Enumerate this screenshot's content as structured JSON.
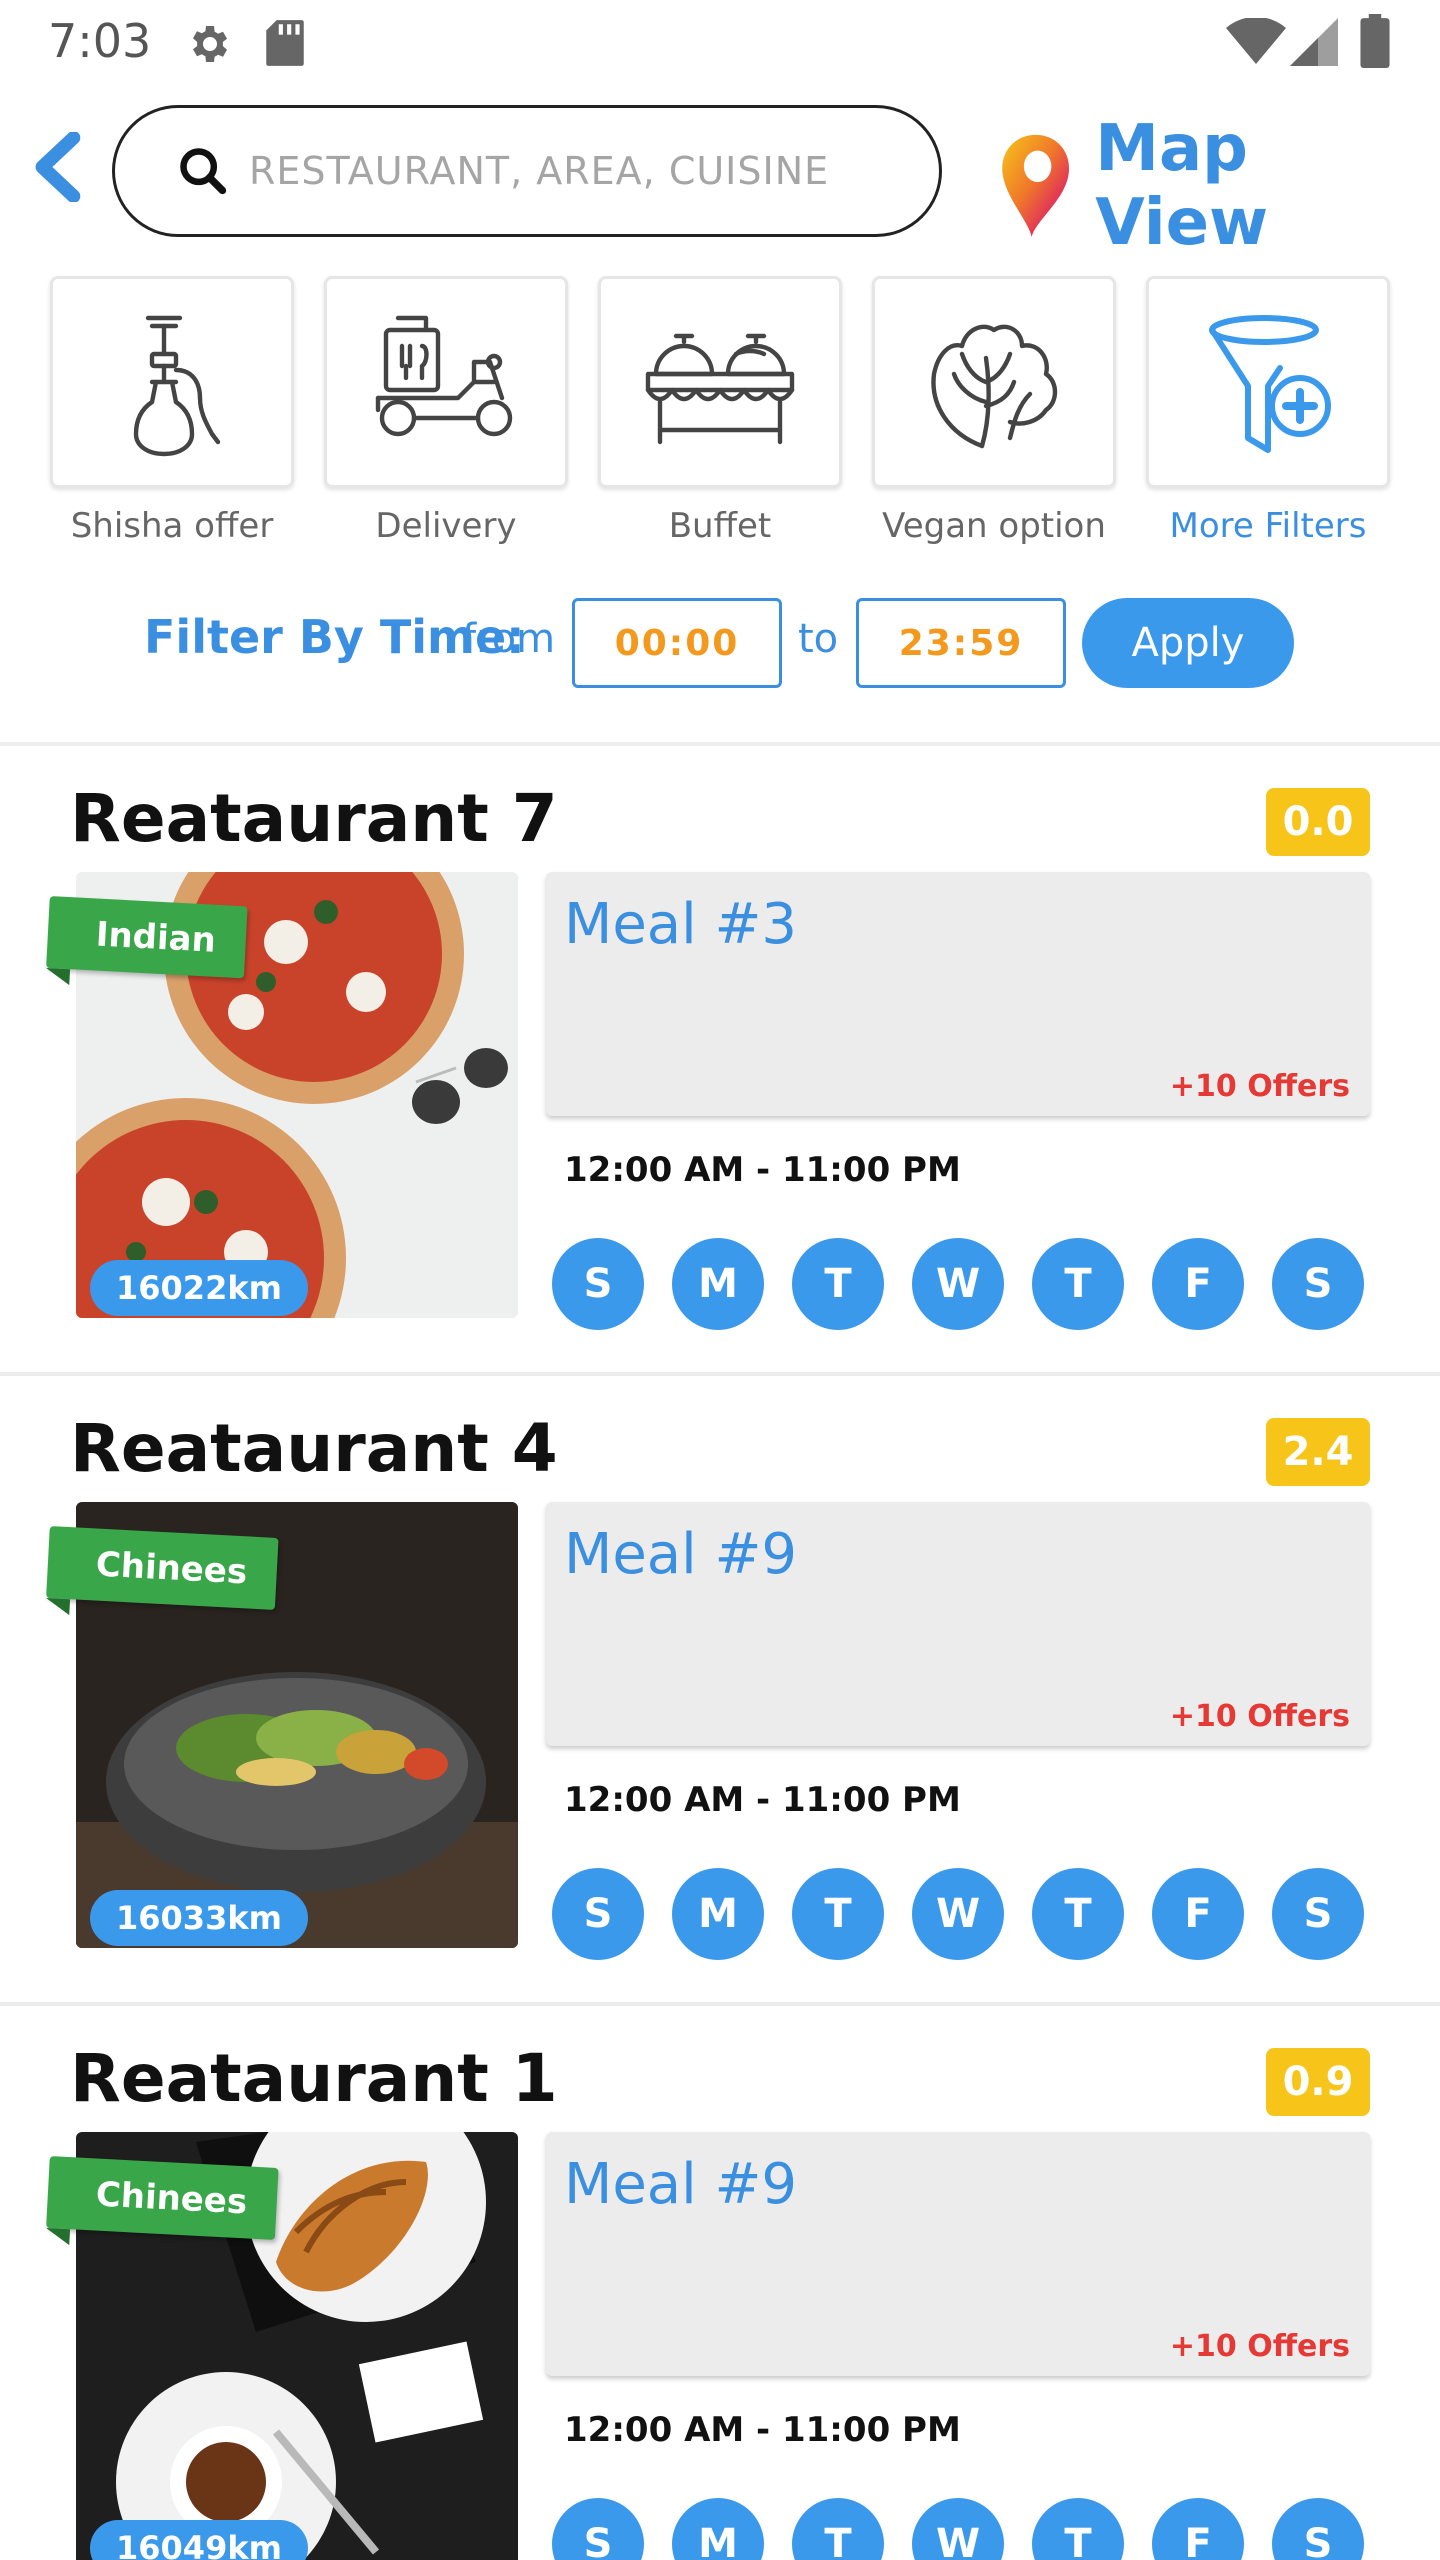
{
  "status_bar": {
    "time": "7:03",
    "icons": [
      "gear-icon",
      "sd-card-icon",
      "wifi-icon",
      "signal-icon",
      "battery-icon"
    ]
  },
  "header": {
    "back_icon": "chevron-left-icon",
    "search": {
      "placeholder": "RESTAURANT, AREA, CUISINE"
    },
    "map_view_label": "Map View"
  },
  "filters": [
    {
      "label": "Shisha offer",
      "icon": "shisha-icon"
    },
    {
      "label": "Delivery",
      "icon": "delivery-scooter-icon"
    },
    {
      "label": "Buffet",
      "icon": "buffet-icon"
    },
    {
      "label": "Vegan option",
      "icon": "lettuce-icon"
    },
    {
      "label": "More Filters",
      "icon": "funnel-plus-icon"
    }
  ],
  "time_filter": {
    "title": "Filter By Time:",
    "from_label": "from",
    "from_value": "00:00",
    "to_label": "to",
    "to_value": "23:59",
    "apply_label": "Apply"
  },
  "restaurants": [
    {
      "name": "Reataurant 7",
      "rating": "0.0",
      "cuisine": "Indian",
      "distance": "16022km",
      "meal": "Meal #3",
      "offers": "+10 Offers",
      "hours": "12:00 AM - 11:00 PM",
      "days": [
        "S",
        "M",
        "T",
        "W",
        "T",
        "F",
        "S"
      ]
    },
    {
      "name": "Reataurant 4",
      "rating": "2.4",
      "cuisine": "Chinees",
      "distance": "16033km",
      "meal": "Meal #9",
      "offers": "+10 Offers",
      "hours": "12:00 AM - 11:00 PM",
      "days": [
        "S",
        "M",
        "T",
        "W",
        "T",
        "F",
        "S"
      ]
    },
    {
      "name": "Reataurant 1",
      "rating": "0.9",
      "cuisine": "Chinees",
      "distance": "16049km",
      "meal": "Meal #9",
      "offers": "+10 Offers",
      "hours": "12:00 AM - 11:00 PM",
      "days": [
        "S",
        "M",
        "T",
        "W",
        "T",
        "F",
        "S"
      ]
    }
  ],
  "colors": {
    "accent": "#3b99ec",
    "rating": "#f7c51a",
    "cuisine_tag": "#3aa64a",
    "offers": "#e53935",
    "time_value": "#f39a1e"
  }
}
